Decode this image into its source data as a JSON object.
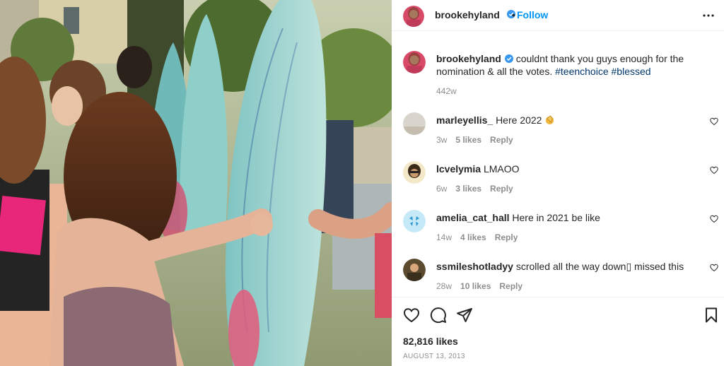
{
  "post": {
    "image_alt": "",
    "author": "brookehyland",
    "follow_label": "Follow",
    "separator": "•",
    "caption_text": "couldnt thank you guys enough for the nomination & all the votes.",
    "hashtags": [
      "#teenchoice",
      "#blessed"
    ],
    "caption_time": "442w",
    "likes": "82,816 likes",
    "date": "AUGUST 13, 2013",
    "verified_color": "#3897f0",
    "link_color": "#0095f6"
  },
  "comments": [
    {
      "user": "marleyellis_",
      "text": "Here 2022",
      "emoji": "clapping-hands-icon",
      "time": "3w",
      "likes": "5 likes",
      "reply": "Reply"
    },
    {
      "user": "lcvelymia",
      "text": "LMAOO",
      "time": "6w",
      "likes": "3 likes",
      "reply": "Reply"
    },
    {
      "user": "amelia_cat_hall",
      "text": "Here in 2021 be like",
      "time": "14w",
      "likes": "4 likes",
      "reply": "Reply"
    },
    {
      "user": "ssmileshotladyy",
      "text": "scrolled all the way down▯ missed this",
      "time": "28w",
      "likes": "10 likes",
      "reply": "Reply"
    }
  ],
  "icons": [
    "more-options-icon",
    "heart-icon",
    "comment-icon",
    "share-icon",
    "bookmark-icon",
    "verified-icon"
  ]
}
